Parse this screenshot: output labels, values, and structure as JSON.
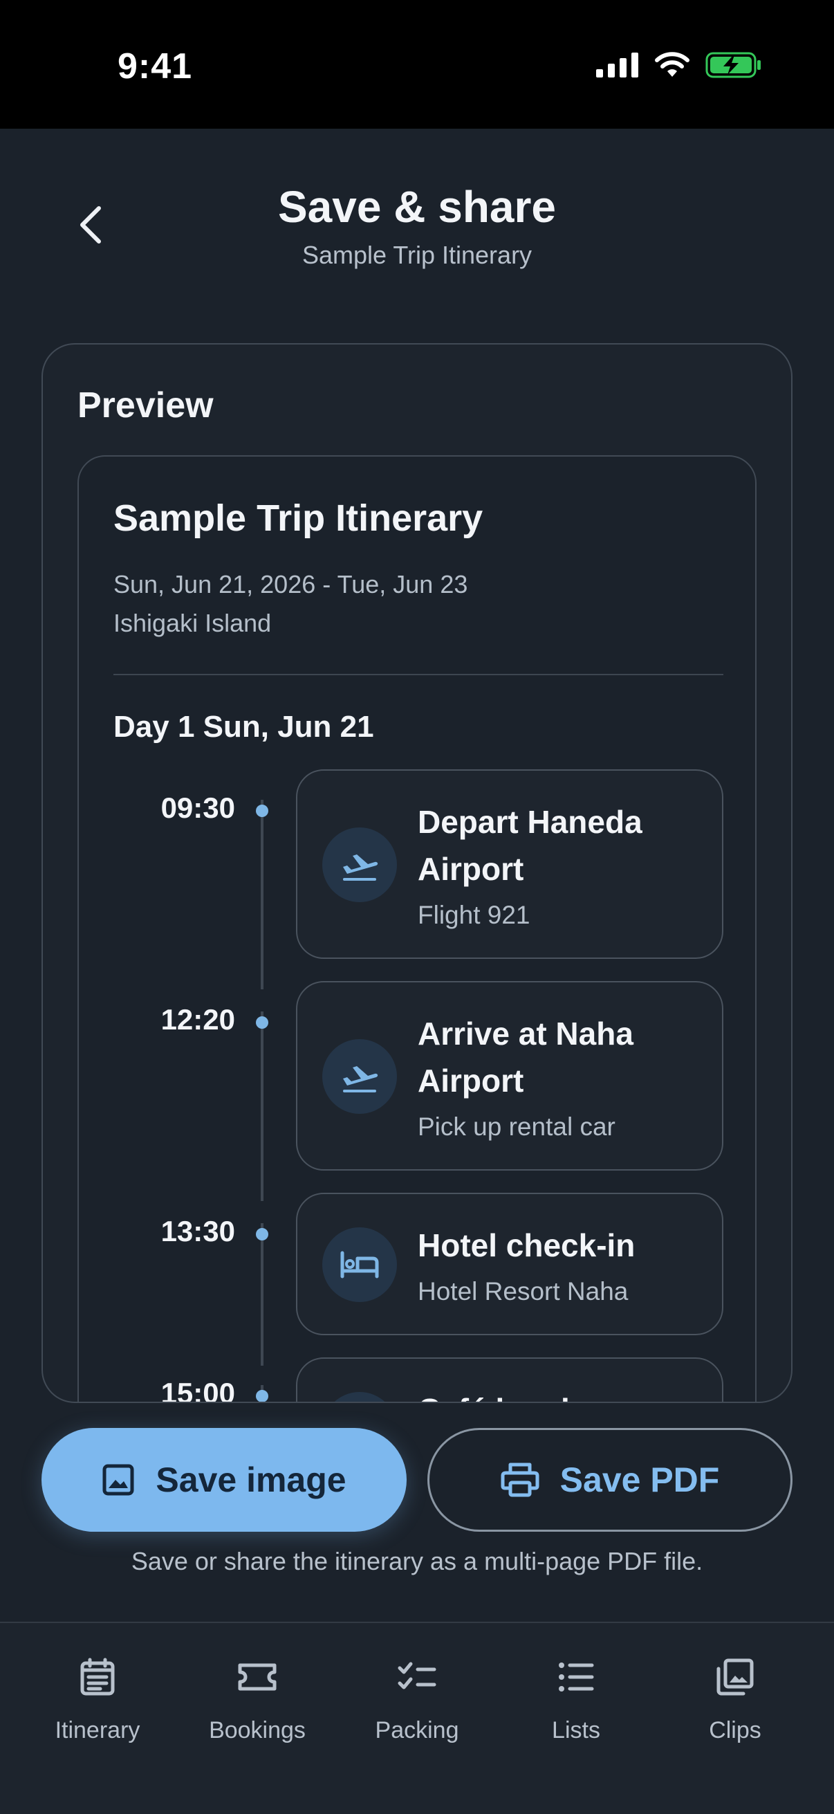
{
  "status": {
    "time": "9:41"
  },
  "header": {
    "title": "Save & share",
    "subtitle": "Sample Trip Itinerary"
  },
  "preview": {
    "label": "Preview",
    "doc": {
      "title": "Sample Trip Itinerary",
      "dates": "Sun, Jun 21, 2026 - Tue, Jun 23",
      "place": "Ishigaki Island",
      "day_heading": "Day 1 Sun, Jun 21",
      "events": [
        {
          "time": "09:30",
          "icon": "flight-takeoff-icon",
          "title": "Depart Haneda Airport",
          "sub": "Flight 921"
        },
        {
          "time": "12:20",
          "icon": "flight-takeoff-icon",
          "title": "Arrive at Naha Airport",
          "sub": "Pick up rental car"
        },
        {
          "time": "13:30",
          "icon": "hotel-bed-icon",
          "title": "Hotel check-in",
          "sub": "Hotel Resort Naha"
        },
        {
          "time": "15:00",
          "icon": "cafe-icon",
          "title": "Café lunch",
          "sub": ""
        }
      ]
    }
  },
  "actions": {
    "save_image": "Save image",
    "save_pdf": "Save PDF",
    "help": "Save or share the itinerary as a multi-page PDF file."
  },
  "tabs": [
    {
      "label": "Itinerary",
      "icon": "itinerary-icon"
    },
    {
      "label": "Bookings",
      "icon": "ticket-icon"
    },
    {
      "label": "Packing",
      "icon": "checklist-icon"
    },
    {
      "label": "Lists",
      "icon": "list-icon"
    },
    {
      "label": "Clips",
      "icon": "gallery-icon"
    }
  ],
  "colors": {
    "background": "#1b222b",
    "accent": "#7db8ee",
    "text": "#f3f5f8",
    "muted": "#b5bfca"
  }
}
